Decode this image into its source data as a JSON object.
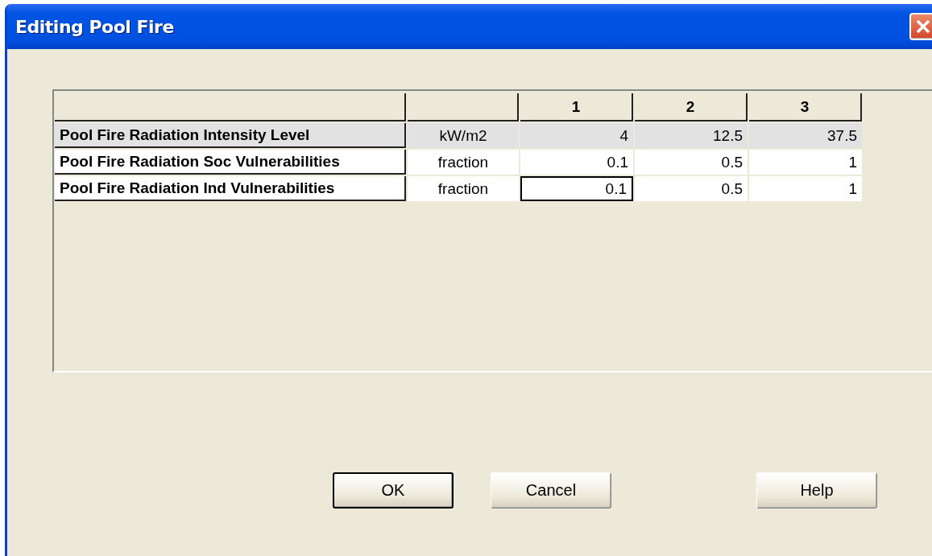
{
  "window": {
    "title": "Editing Pool Fire"
  },
  "table": {
    "columns": [
      "",
      "",
      "1",
      "2",
      "3"
    ],
    "rows": [
      {
        "label": "Pool Fire Radiation Intensity Level",
        "unit": "kW/m2",
        "readonly": true,
        "cells": [
          {
            "value": "4",
            "selected": false
          },
          {
            "value": "12.5",
            "selected": false
          },
          {
            "value": "37.5",
            "selected": false
          }
        ]
      },
      {
        "label": "Pool Fire Radiation Soc Vulnerabilities",
        "unit": "fraction",
        "readonly": false,
        "cells": [
          {
            "value": "0.1",
            "selected": false
          },
          {
            "value": "0.5",
            "selected": false
          },
          {
            "value": "1",
            "selected": false
          }
        ]
      },
      {
        "label": "Pool Fire Radiation Ind Vulnerabilities",
        "unit": "fraction",
        "readonly": false,
        "cells": [
          {
            "value": "0.1",
            "selected": true
          },
          {
            "value": "0.5",
            "selected": false
          },
          {
            "value": "1",
            "selected": false
          }
        ]
      }
    ]
  },
  "buttons": [
    {
      "label": "OK",
      "default": true
    },
    {
      "label": "Cancel",
      "default": false
    },
    {
      "label": "Help",
      "default": false
    }
  ]
}
